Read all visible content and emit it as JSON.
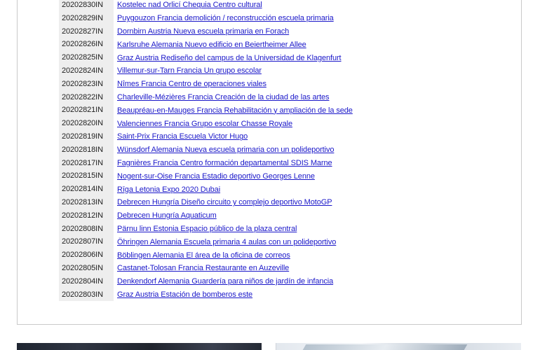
{
  "projects": [
    {
      "code": "20202830IN",
      "title": "Kostelec nad Orlicí Chequia Centro cultural"
    },
    {
      "code": "20202829IN",
      "title": "Puygouzon Francia demolición / reconstrucción escuela primaria "
    },
    {
      "code": "20202827IN",
      "title": "Dornbirn Austria Nueva escuela primaria en Forach"
    },
    {
      "code": "20202826IN",
      "title": "Karlsruhe Alemania Nuevo edificio en Beiertheimer Allee"
    },
    {
      "code": "20202825IN",
      "title": "Graz Austria Rediseño del campus de la Universidad de Klagenfurt "
    },
    {
      "code": "20202824IN",
      "title": "Villemur-sur-Tarn Francia Un grupo escolar"
    },
    {
      "code": "20202823IN",
      "title": "Nîmes Francia Centro de operaciones viales "
    },
    {
      "code": "20202822IN",
      "title": "Charleville-Mézières Francia Creación de la ciudad de las artes "
    },
    {
      "code": "20202821IN",
      "title": "Beaupréau-en-Mauges Francia Rehabilitación y ampliación de la sede"
    },
    {
      "code": "20202820IN",
      "title": "Valenciennes Francia Grupo escolar Chasse Royale"
    },
    {
      "code": "20202819IN",
      "title": "Saint-Prix Francia Escuela Victor Hugo "
    },
    {
      "code": "20202818IN",
      "title": "Wünsdorf Alemania Nueva escuela primaria con un polideportivo"
    },
    {
      "code": "20202817IN",
      "title": "Fagnières Francia Centro formación departamental SDIS Marne"
    },
    {
      "code": "20202815IN",
      "title": "Nogent-sur-Oise Francia Estadio deportivo Georges Lenne"
    },
    {
      "code": "20202814IN",
      "title": "Rīga Letonia Expo 2020 Dubai"
    },
    {
      "code": "20202813IN",
      "title": "Debrecen Hungría Diseño circuito y complejo deportivo MotoGP"
    },
    {
      "code": "20202812IN",
      "title": "Debrecen Hungría Aquaticum"
    },
    {
      "code": "20202808IN",
      "title": "Pärnu linn Estonia Espacio público de la plaza central"
    },
    {
      "code": "20202807IN",
      "title": "Öhringen Alemania Escuela primaria 4 aulas con un polideportivo"
    },
    {
      "code": "20202806IN",
      "title": "Böblingen Alemania El área de la oficina de correos"
    },
    {
      "code": "20202805IN",
      "title": "Castanet-Tolosan Francia Restaurante en Auzeville"
    },
    {
      "code": "20202804IN",
      "title": "Denkendorf Alemania Guardería para niños de jardín de infancia"
    },
    {
      "code": "20202803IN",
      "title": "Graz Austria Estación de bomberos este"
    }
  ],
  "colors": {
    "link": "#1a17c9",
    "code_background": "#eeeeee",
    "panel_border": "#c9c9c9"
  }
}
